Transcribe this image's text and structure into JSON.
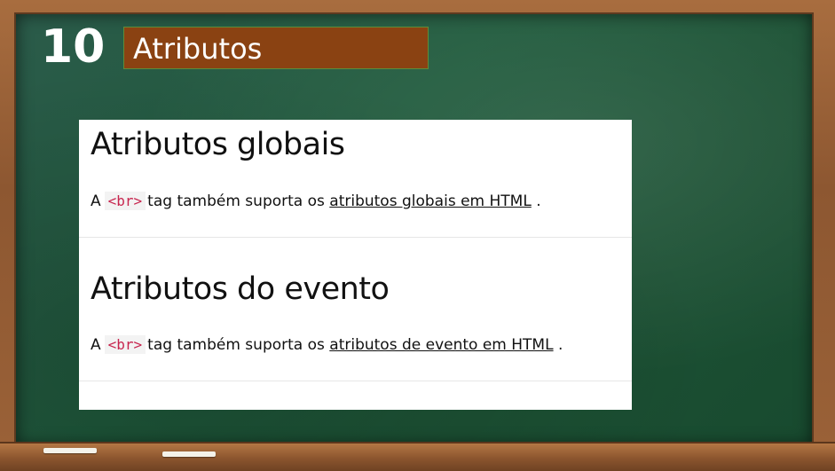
{
  "slide": {
    "number": "10",
    "title": "Atributos"
  },
  "sections": [
    {
      "heading": "Atributos globais",
      "text_before": "A",
      "code": "<br>",
      "text_middle": "tag também suporta os",
      "link_text": "atributos globais em HTML",
      "text_after": "."
    },
    {
      "heading": "Atributos do evento",
      "text_before": "A",
      "code": "<br>",
      "text_middle": "tag também suporta os",
      "link_text": "atributos de evento em HTML",
      "text_after": "."
    }
  ],
  "colors": {
    "board": "#1f5a3c",
    "frame": "#8d5731",
    "title_box": "#8a4212",
    "code_text": "#c7254e"
  }
}
